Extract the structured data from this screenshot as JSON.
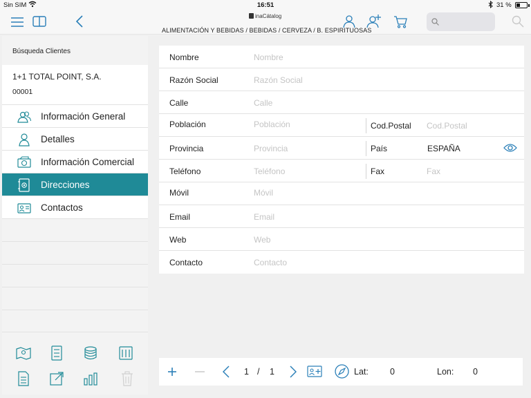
{
  "status": {
    "carrier": "Sin SIM",
    "time": "16:51",
    "battery": "31 %"
  },
  "nav": {
    "brand": "inaCátalog",
    "breadcrumb": "ALIMENTACIÓN Y BEBIDAS / BEBIDAS / CERVEZA / B. ESPIRITUOSAS",
    "search_placeholder": ""
  },
  "sidebar": {
    "title": "Búsqueda Clientes",
    "client_name": "1+1 TOTAL POINT, S.A.",
    "client_code": "00001",
    "items": [
      {
        "label": "Información General",
        "icon": "users-icon",
        "active": false
      },
      {
        "label": "Detalles",
        "icon": "user-icon",
        "active": false
      },
      {
        "label": "Información Comercial",
        "icon": "money-icon",
        "active": false
      },
      {
        "label": "Direcciones",
        "icon": "address-book-icon",
        "active": true
      },
      {
        "label": "Contactos",
        "icon": "contact-card-icon",
        "active": false
      }
    ]
  },
  "form": {
    "nombre": {
      "label": "Nombre",
      "placeholder": "Nombre"
    },
    "razon_social": {
      "label": "Razón Social",
      "placeholder": "Razón Social"
    },
    "calle": {
      "label": "Calle",
      "placeholder": "Calle"
    },
    "poblacion": {
      "label": "Población",
      "placeholder": "Población"
    },
    "cod_postal": {
      "label": "Cod.Postal",
      "placeholder": "Cod.Postal"
    },
    "provincia": {
      "label": "Provincia",
      "placeholder": "Provincia"
    },
    "pais": {
      "label": "País",
      "value": "ESPAÑA"
    },
    "telefono": {
      "label": "Teléfono",
      "placeholder": "Teléfono"
    },
    "fax": {
      "label": "Fax",
      "placeholder": "Fax"
    },
    "movil": {
      "label": "Móvil",
      "placeholder": "Móvil"
    },
    "email": {
      "label": "Email",
      "placeholder": "Email"
    },
    "web": {
      "label": "Web",
      "placeholder": "Web"
    },
    "contacto": {
      "label": "Contacto",
      "placeholder": "Contacto"
    }
  },
  "pager": {
    "current": "1",
    "separator": "/",
    "total": "1",
    "lat_label": "Lat:",
    "lat_value": "0",
    "lon_label": "Lon:",
    "lon_value": "0"
  },
  "colors": {
    "accent": "#1f8a97",
    "icon_blue": "#2a7fb8"
  }
}
